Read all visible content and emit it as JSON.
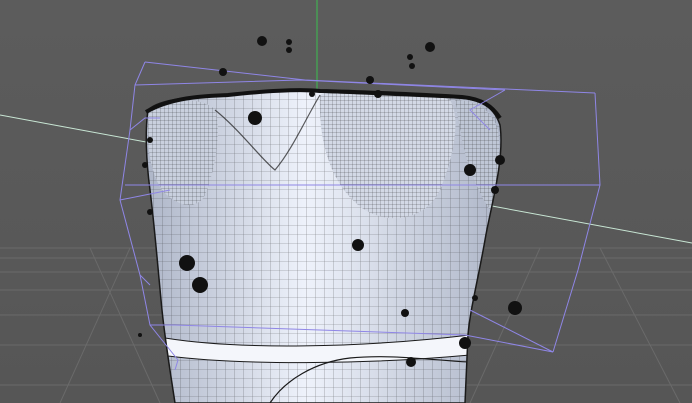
{
  "viewport": {
    "background_top": "#5c5c5c",
    "background_bottom": "#565656",
    "grid_color": "#6a6a6a",
    "x_axis_color": "#c8e6d4",
    "y_axis_color": "#3bbf4f",
    "bounding_box_color": "#8f86e6",
    "mesh_fill": "#eef2fb",
    "mesh_shade": "#aeb6c8",
    "wire_color": "#1a1a1a",
    "particle_color": "#111111"
  }
}
